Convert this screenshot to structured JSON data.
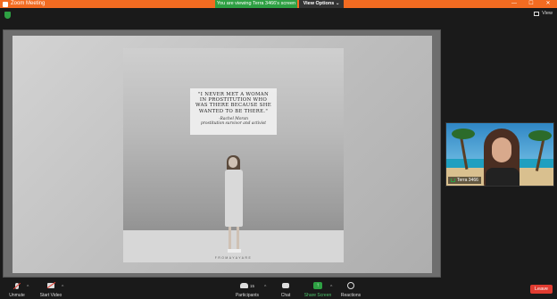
{
  "window": {
    "title": "Zoom Meeting",
    "viewing_banner": "You are viewing Terra 3466's screen",
    "view_options": "View Options ⌄",
    "controls": [
      "—",
      "☐",
      "✕"
    ]
  },
  "top_bar": {
    "view_label": "View"
  },
  "slide": {
    "quote": "\"I NEVER MET A WOMAN IN PROSTITUTION WHO WAS THERE BECAUSE SHE WANTED TO BE THERE.\"",
    "author": "-Rachel Moran",
    "role": "prostitution survivor and activist",
    "credit": "FROMAYAYARE"
  },
  "video_tile": {
    "participant_name": "Terra 3466"
  },
  "toolbar": {
    "unmute_label": "Unmute",
    "start_video_label": "Start Video",
    "participants_label": "Participants",
    "participants_count": "15",
    "chat_label": "Chat",
    "share_screen_label": "Share Screen",
    "reactions_label": "Reactions",
    "leave_label": "Leave",
    "caret": "^"
  },
  "colors": {
    "title_bar": "#f26b21",
    "banner_green": "#2ea043",
    "leave_red": "#e03c31"
  }
}
